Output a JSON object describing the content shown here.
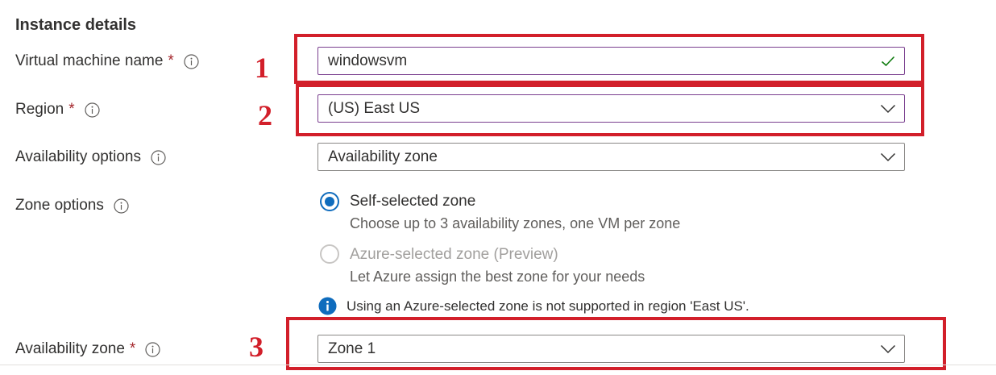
{
  "section": {
    "title": "Instance details"
  },
  "fields": {
    "vm_name": {
      "label": "Virtual machine name",
      "required": "*",
      "value": "windowsvm"
    },
    "region": {
      "label": "Region",
      "required": "*",
      "value": "(US) East US"
    },
    "availability_options": {
      "label": "Availability options",
      "value": "Availability zone"
    },
    "zone_options": {
      "label": "Zone options",
      "options": [
        {
          "label": "Self-selected zone",
          "description": "Choose up to 3 availability zones, one VM per zone",
          "selected": true,
          "disabled": false
        },
        {
          "label": "Azure-selected zone (Preview)",
          "description": "Let Azure assign the best zone for your needs",
          "selected": false,
          "disabled": true
        }
      ],
      "info_message": "Using an Azure-selected zone is not supported in region 'East US'."
    },
    "availability_zone": {
      "label": "Availability zone",
      "required": "*",
      "value": "Zone 1"
    }
  },
  "annotations": [
    "1",
    "2",
    "3"
  ],
  "colors": {
    "annotation": "#d21f2a",
    "required": "#a4262c",
    "accent": "#0f6cbd",
    "valid_check": "#107c10"
  },
  "icons": {
    "info": "info-circle-icon",
    "valid": "checkmark-icon",
    "dropdown": "chevron-down-icon",
    "message": "info-filled-icon"
  }
}
